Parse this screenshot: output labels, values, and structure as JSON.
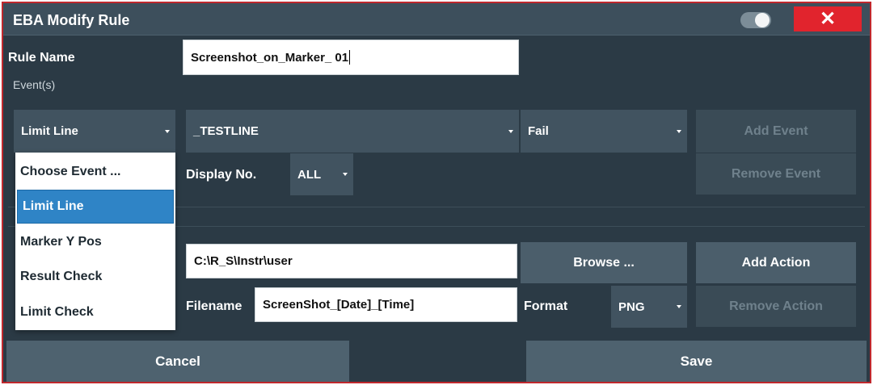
{
  "window": {
    "title": "EBA Modify Rule",
    "close_label": "✕"
  },
  "rule_name": {
    "label": "Rule Name",
    "value": "Screenshot_on_Marker_ 01"
  },
  "events": {
    "section_label": "Event(s)",
    "event_type": {
      "selected": "Limit Line"
    },
    "limit_line": {
      "selected": "_TESTLINE"
    },
    "condition": {
      "selected": "Fail"
    },
    "display_label": "Display No.",
    "display_value": "ALL",
    "add_event": "Add Event",
    "remove_event": "Remove Event",
    "menu": [
      "Choose Event ...",
      "Limit Line",
      "Marker Y Pos",
      "Result Check",
      "Limit Check"
    ],
    "menu_selected_index": 1
  },
  "actions": {
    "path_value": "C:\\R_S\\Instr\\user",
    "browse_label": "Browse ...",
    "add_action": "Add Action",
    "remove_action": "Remove Action",
    "filename_label": "Filename",
    "filename_value": "ScreenShot_[Date]_[Time]",
    "format_label": "Format",
    "format_value": "PNG"
  },
  "footer": {
    "cancel": "Cancel",
    "save": "Save"
  },
  "colors": {
    "background": "#2b3a45",
    "title_bar": "#3d4f5c",
    "close_button": "#e1242d",
    "selection": "#2f84c6",
    "border": "#c0282d"
  },
  "icons": {
    "close": "close-icon",
    "dropdown": "chevron-down-icon",
    "toggle": "toggle-switch"
  }
}
